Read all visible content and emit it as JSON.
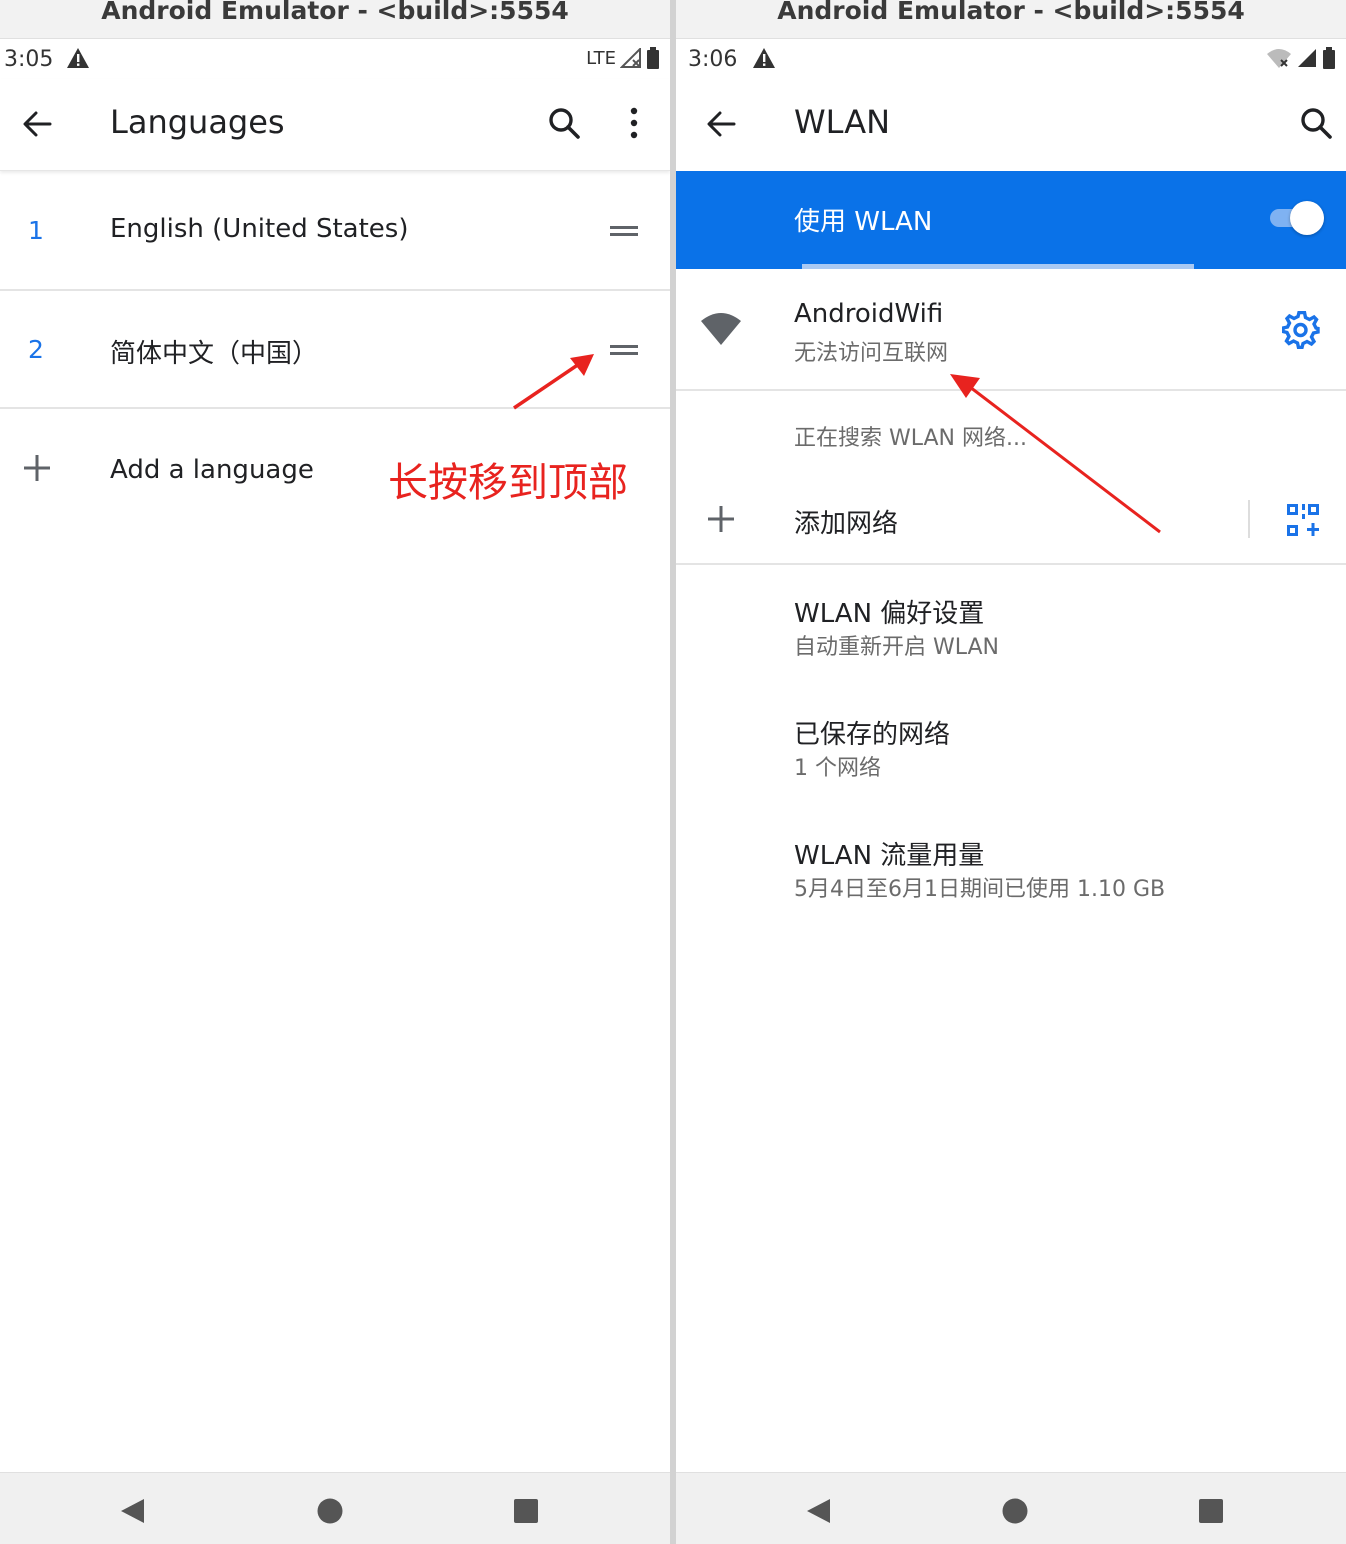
{
  "left": {
    "window_title": "Android Emulator - <build>:5554",
    "status": {
      "time": "3:05",
      "network": "LTE"
    },
    "appbar": {
      "title": "Languages"
    },
    "languages": [
      {
        "index": "1",
        "name": "English (United States)"
      },
      {
        "index": "2",
        "name": "简体中文（中国）"
      }
    ],
    "add_language": "Add a language",
    "annotation": "长按移到顶部"
  },
  "right": {
    "window_title": "Android Emulator - <build>:5554",
    "status": {
      "time": "3:06"
    },
    "appbar": {
      "title": "WLAN"
    },
    "use_wlan": {
      "label": "使用 WLAN",
      "enabled": true
    },
    "network": {
      "name": "AndroidWifi",
      "status": "无法访问互联网"
    },
    "searching": "正在搜索 WLAN 网络...",
    "add_network": "添加网络",
    "items": [
      {
        "title": "WLAN 偏好设置",
        "subtitle": "自动重新开启 WLAN"
      },
      {
        "title": "已保存的网络",
        "subtitle": "1 个网络"
      },
      {
        "title": "WLAN 流量用量",
        "subtitle": "5月4日至6月1日期间已使用 1.10 GB"
      }
    ]
  },
  "colors": {
    "accent": "#0a72e8",
    "annotation": "#e8231f"
  }
}
